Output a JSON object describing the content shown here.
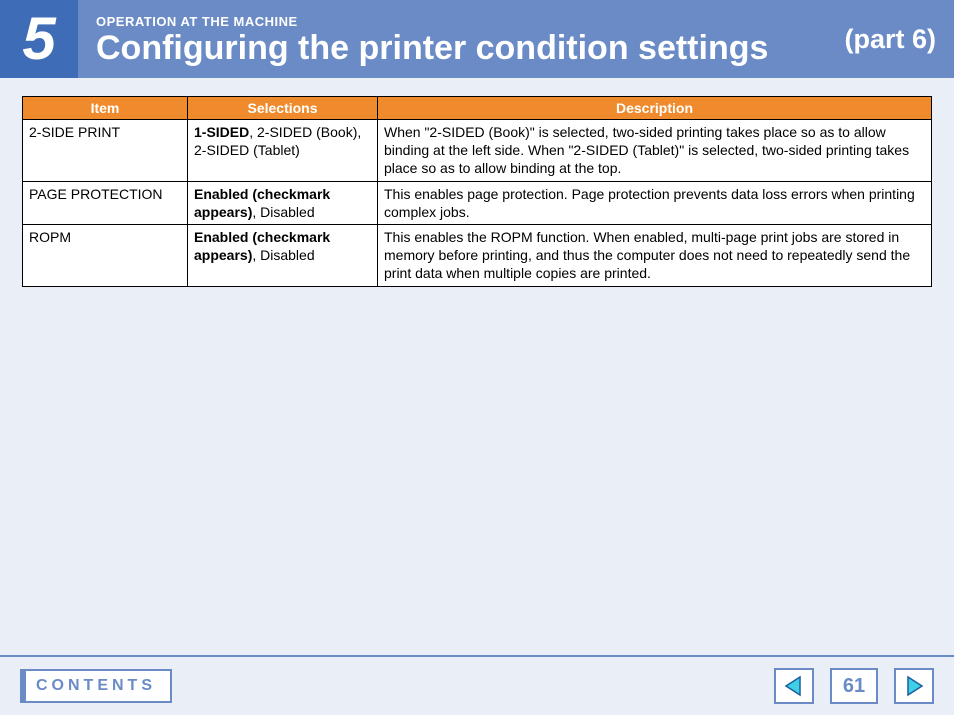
{
  "header": {
    "chapter_number": "5",
    "overline": "OPERATION AT THE MACHINE",
    "title": "Configuring the printer condition settings",
    "part": "(part 6)"
  },
  "table": {
    "columns": {
      "c1": "Item",
      "c2": "Selections",
      "c3": "Description"
    },
    "rows": [
      {
        "item": "2-SIDE PRINT",
        "sel_bold": "1-SIDED",
        "sel_rest": ", 2-SIDED (Book), 2-SIDED (Tablet)",
        "desc": "When \"2-SIDED (Book)\" is selected, two-sided printing takes place so as to allow binding at the left side. When \"2-SIDED (Tablet)\" is selected, two-sided printing takes place so as to allow binding at the top."
      },
      {
        "item": "PAGE PROTECTION",
        "sel_bold": "Enabled (checkmark appears)",
        "sel_rest": ", Disabled",
        "desc": "This enables page protection. Page protection prevents data loss errors when printing complex jobs."
      },
      {
        "item": "ROPM",
        "sel_bold": "Enabled (checkmark appears)",
        "sel_rest": ", Disabled",
        "desc": "This enables the ROPM function. When enabled, multi-page print jobs are stored in memory before printing, and thus the computer does not need to repeatedly send the print data when multiple copies are printed."
      }
    ]
  },
  "footer": {
    "contents_label": "CONTENTS",
    "page_number": "61"
  }
}
